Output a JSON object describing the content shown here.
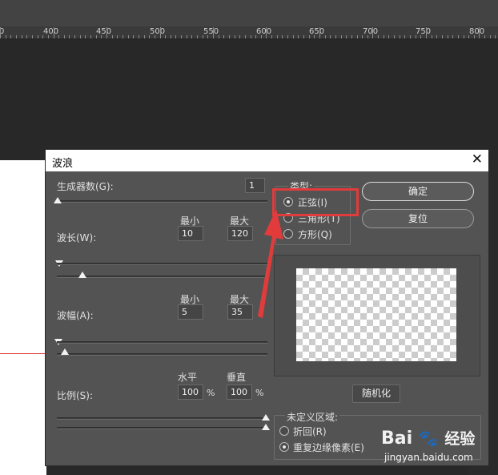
{
  "ruler": {
    "labels": [
      "0",
      "400",
      "450",
      "500",
      "550",
      "600",
      "650",
      "700",
      "750",
      "800"
    ]
  },
  "dialog": {
    "title": "波浪",
    "generators": {
      "label": "生成器数(G):",
      "value": "1"
    },
    "min_label": "最小",
    "max_label": "最大",
    "wavelength": {
      "label": "波长(W):",
      "min": "10",
      "max": "120"
    },
    "amplitude": {
      "label": "波幅(A):",
      "min": "5",
      "max": "35"
    },
    "scale": {
      "label": "比例(S):",
      "h_label": "水平",
      "v_label": "垂直",
      "h": "100",
      "v": "100",
      "unit": "%"
    },
    "type": {
      "legend": "类型:",
      "options": [
        "正弦(I)",
        "三角形(T)",
        "方形(Q)"
      ],
      "selected": 0
    },
    "ok_label": "确定",
    "reset_label": "复位",
    "randomize_label": "随机化",
    "undefined_areas": {
      "legend": "未定义区域:",
      "options": [
        "折回(R)",
        "重复边缘像素(E)"
      ],
      "selected": 1
    }
  },
  "watermark": {
    "brand": "Bai",
    "brand2": "经验",
    "url": "jingyan.baidu.com"
  },
  "colors": {
    "highlight": "#e23b3b",
    "dialog_bg": "#535353"
  }
}
